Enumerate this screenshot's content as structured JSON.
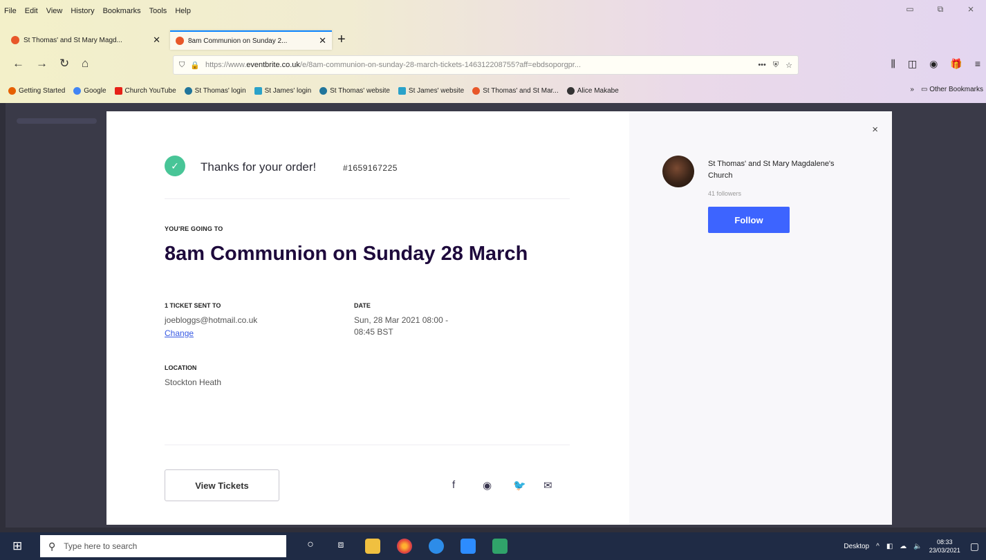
{
  "menubar": {
    "items": [
      "File",
      "Edit",
      "View",
      "History",
      "Bookmarks",
      "Tools",
      "Help"
    ]
  },
  "window": {
    "minimize": "▭",
    "restore": "⧉",
    "close": "⨯"
  },
  "tabs": [
    {
      "title": "St Thomas' and St Mary Magd...",
      "close": "✕"
    },
    {
      "title": "8am Communion on Sunday 2...",
      "close": "✕"
    }
  ],
  "new_tab_glyph": "+",
  "address": {
    "url_prefix": "https://www.",
    "url_domain": "eventbrite.co.uk",
    "url_rest": "/e/8am-communion-on-sunday-28-march-tickets-146312208755?aff=ebdsoporgpr...",
    "more": "•••"
  },
  "bookmarks": [
    {
      "label": "Getting Started",
      "color": "#e66000"
    },
    {
      "label": "Google",
      "color": "#4285f4"
    },
    {
      "label": "Church YouTube",
      "color": "#e62117"
    },
    {
      "label": "St Thomas' login",
      "color": "#21759b"
    },
    {
      "label": "St James' login",
      "color": "#2aa2c9"
    },
    {
      "label": "St Thomas' website",
      "color": "#21759b"
    },
    {
      "label": "St James' website",
      "color": "#2aa2c9"
    },
    {
      "label": "St Thomas' and St Mar...",
      "color": "#e8572a"
    },
    {
      "label": "Alice Makabe",
      "color": "#333333"
    }
  ],
  "bookmarks_overflow": "»",
  "other_bookmarks": "Other Bookmarks",
  "order": {
    "close_glyph": "×",
    "check_glyph": "✓",
    "thanks": "Thanks for your order!",
    "order_number": "#1659167225",
    "going_label": "YOU'RE GOING TO",
    "event_title": "8am Communion on Sunday 28 March",
    "ticket_label": "1 TICKET SENT TO",
    "email": "joebloggs@hotmail.co.uk",
    "change": "Change",
    "date_label": "DATE",
    "date_line1": "Sun, 28 Mar 2021 08:00 -",
    "date_line2": "08:45 BST",
    "location_label": "LOCATION",
    "location": "Stockton Heath",
    "view_tickets": "View Tickets",
    "share": {
      "facebook": "f",
      "messenger": "◉",
      "twitter": "🐦",
      "email": "✉"
    }
  },
  "organizer": {
    "name": "St Thomas' and St Mary Magdalene's Church",
    "followers": "41 followers",
    "follow": "Follow"
  },
  "taskbar": {
    "search_placeholder": "Type here to search",
    "desktop_label": "Desktop",
    "time": "08:33",
    "date": "23/03/2021"
  },
  "colors": {
    "accent_blue": "#3d64ff",
    "success_green": "#48c597",
    "title_purple": "#1e0a3c",
    "taskbar": "#1f2b45"
  }
}
